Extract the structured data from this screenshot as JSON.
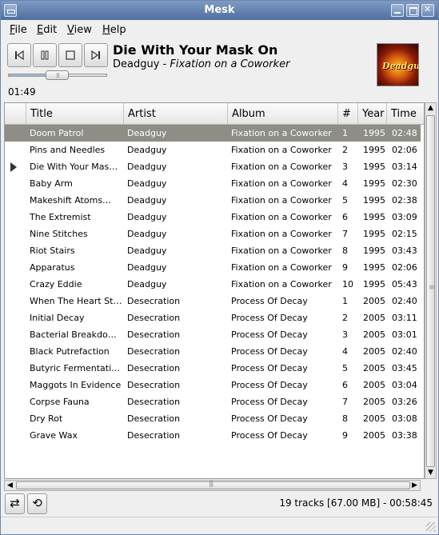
{
  "window": {
    "title": "Mesk"
  },
  "menu": [
    {
      "u": "F",
      "rest": "ile"
    },
    {
      "u": "E",
      "rest": "dit"
    },
    {
      "u": "V",
      "rest": "iew"
    },
    {
      "u": "H",
      "rest": "elp"
    }
  ],
  "player": {
    "song_title": "Die With Your Mask On",
    "artist": "Deadguy",
    "separator": " - ",
    "album": "Fixation on a Coworker",
    "elapsed": "01:49",
    "progress_fraction": 0.55,
    "cover_text": "Deadguy"
  },
  "columns": [
    "Title",
    "Artist",
    "Album",
    "#",
    "Year",
    "Time"
  ],
  "tracks": [
    {
      "title": "Doom Patrol",
      "artist": "Deadguy",
      "album": "Fixation on a Coworker",
      "num": "1",
      "year": "1995",
      "time": "02:48",
      "selected": true
    },
    {
      "title": "Pins and Needles",
      "artist": "Deadguy",
      "album": "Fixation on a Coworker",
      "num": "2",
      "year": "1995",
      "time": "02:06"
    },
    {
      "title": "Die With Your Mas…",
      "artist": "Deadguy",
      "album": "Fixation on a Coworker",
      "num": "3",
      "year": "1995",
      "time": "03:14",
      "playing": true
    },
    {
      "title": "Baby Arm",
      "artist": "Deadguy",
      "album": "Fixation on a Coworker",
      "num": "4",
      "year": "1995",
      "time": "02:30"
    },
    {
      "title": "Makeshift Atoms…",
      "artist": "Deadguy",
      "album": "Fixation on a Coworker",
      "num": "5",
      "year": "1995",
      "time": "02:38"
    },
    {
      "title": "The Extremist",
      "artist": "Deadguy",
      "album": "Fixation on a Coworker",
      "num": "6",
      "year": "1995",
      "time": "03:09"
    },
    {
      "title": "Nine Stitches",
      "artist": "Deadguy",
      "album": "Fixation on a Coworker",
      "num": "7",
      "year": "1995",
      "time": "02:15"
    },
    {
      "title": "Riot Stairs",
      "artist": "Deadguy",
      "album": "Fixation on a Coworker",
      "num": "8",
      "year": "1995",
      "time": "03:43"
    },
    {
      "title": "Apparatus",
      "artist": "Deadguy",
      "album": "Fixation on a Coworker",
      "num": "9",
      "year": "1995",
      "time": "02:06"
    },
    {
      "title": "Crazy Eddie",
      "artist": "Deadguy",
      "album": "Fixation on a Coworker",
      "num": "10",
      "year": "1995",
      "time": "05:43"
    },
    {
      "title": "When The Heart St…",
      "artist": "Desecration",
      "album": "Process Of Decay",
      "num": "1",
      "year": "2005",
      "time": "02:40"
    },
    {
      "title": "Initial Decay",
      "artist": "Desecration",
      "album": "Process Of Decay",
      "num": "2",
      "year": "2005",
      "time": "03:11"
    },
    {
      "title": "Bacterial Breakdo…",
      "artist": "Desecration",
      "album": "Process Of Decay",
      "num": "3",
      "year": "2005",
      "time": "03:01"
    },
    {
      "title": "Black Putrefaction",
      "artist": "Desecration",
      "album": "Process Of Decay",
      "num": "4",
      "year": "2005",
      "time": "02:40"
    },
    {
      "title": "Butyric Fermentati…",
      "artist": "Desecration",
      "album": "Process Of Decay",
      "num": "5",
      "year": "2005",
      "time": "03:45"
    },
    {
      "title": "Maggots In Evidence",
      "artist": "Desecration",
      "album": "Process Of Decay",
      "num": "6",
      "year": "2005",
      "time": "03:04"
    },
    {
      "title": "Corpse Fauna",
      "artist": "Desecration",
      "album": "Process Of Decay",
      "num": "7",
      "year": "2005",
      "time": "03:26"
    },
    {
      "title": "Dry Rot",
      "artist": "Desecration",
      "album": "Process Of Decay",
      "num": "8",
      "year": "2005",
      "time": "03:08"
    },
    {
      "title": "Grave Wax",
      "artist": "Desecration",
      "album": "Process Of Decay",
      "num": "9",
      "year": "2005",
      "time": "03:38"
    }
  ],
  "status": "19 tracks [67.00 MB] - 00:58:45",
  "colors": {
    "selected_row": "#8e8e86",
    "titlebar": "#4f6f9f"
  }
}
